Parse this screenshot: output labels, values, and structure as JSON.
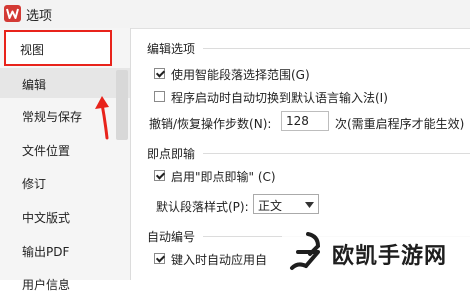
{
  "window": {
    "title": "选项"
  },
  "sidebar": {
    "items": [
      {
        "label": "视图"
      },
      {
        "label": "编辑"
      },
      {
        "label": "常规与保存"
      },
      {
        "label": "文件位置"
      },
      {
        "label": "修订"
      },
      {
        "label": "中文版式"
      },
      {
        "label": "输出PDF"
      },
      {
        "label": "用户信息"
      }
    ]
  },
  "edit_options": {
    "title": "编辑选项",
    "smart_selection": {
      "label": "使用智能段落选择范围(G)",
      "checked": true
    },
    "auto_switch_ime": {
      "label": "程序启动时自动切换到默认语言输入法(I)",
      "checked": false
    },
    "undo_steps": {
      "label": "撤销/恢复操作步数(N):",
      "value": "128",
      "suffix": "次(需重启程序才能生效)"
    }
  },
  "click_and_type": {
    "title": "即点即输",
    "enable": {
      "label": "启用\"即点即输\" (C)",
      "checked": true
    },
    "default_style": {
      "label": "默认段落样式(P):",
      "value": "正文"
    }
  },
  "auto_numbering": {
    "title": "自动编号",
    "apply_on_key": {
      "label": "键入时自动应用自",
      "checked": true
    }
  },
  "watermark": {
    "text": "欧凯手游网"
  },
  "colors": {
    "highlight_border": "#e8231b",
    "logo": "#d33a35"
  }
}
